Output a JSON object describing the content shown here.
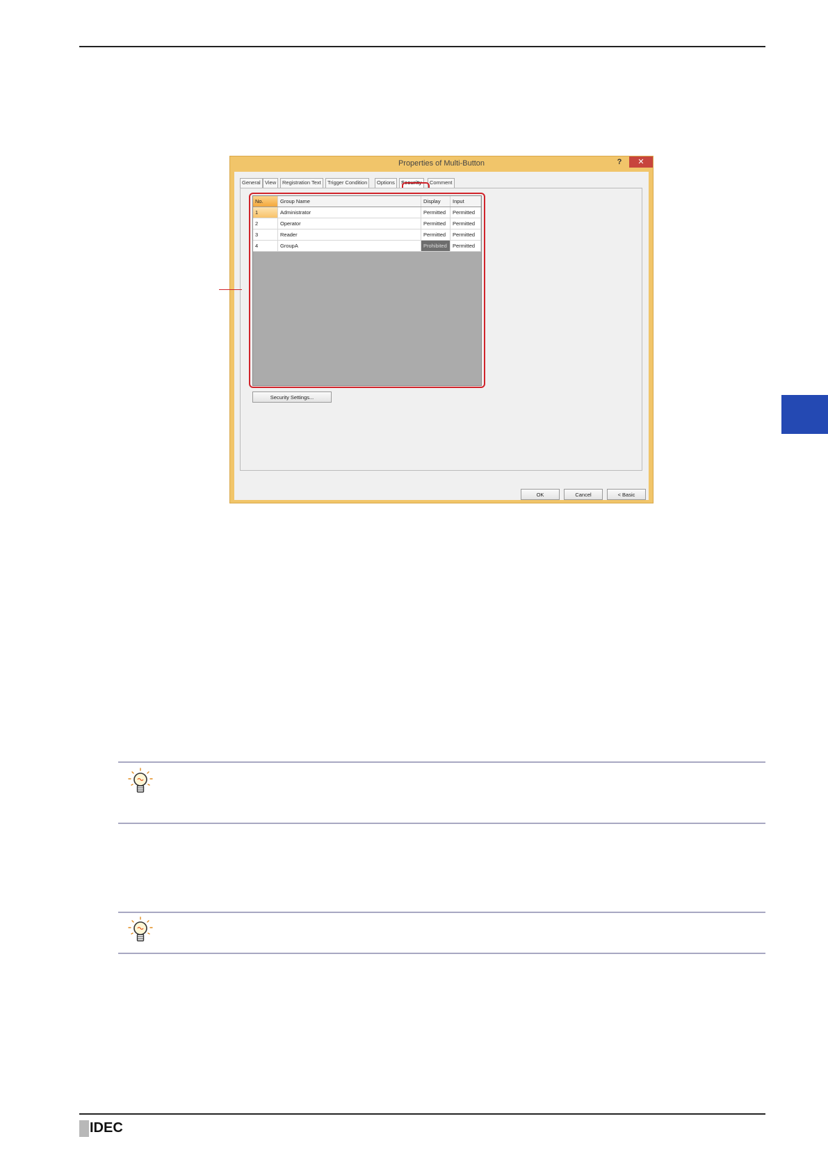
{
  "dialog": {
    "title": "Properties of Multi-Button",
    "help_label": "?",
    "close_label": "✕",
    "tabs": [
      {
        "label": "General"
      },
      {
        "label": "View"
      },
      {
        "label": "Registration Text"
      },
      {
        "label": "Trigger Condition"
      },
      {
        "label": "Options"
      },
      {
        "label": "Security"
      },
      {
        "label": "Comment"
      }
    ],
    "grid": {
      "headers": {
        "no": "No.",
        "name": "Group Name",
        "display": "Display",
        "input": "Input"
      },
      "rows": [
        {
          "no": "1",
          "name": "Administrator",
          "display": "Permitted",
          "input": "Permitted"
        },
        {
          "no": "2",
          "name": "Operator",
          "display": "Permitted",
          "input": "Permitted"
        },
        {
          "no": "3",
          "name": "Reader",
          "display": "Permitted",
          "input": "Permitted"
        },
        {
          "no": "4",
          "name": "GroupA",
          "display": "Prohibited",
          "input": "Permitted"
        }
      ]
    },
    "security_settings_label": "Security Settings...",
    "ok_label": "OK",
    "cancel_label": "Cancel",
    "basic_label": "< Basic"
  },
  "footer": {
    "brand": "IDEC"
  },
  "colors": {
    "accent_blue": "#2449b3",
    "highlight_red": "#d0232a",
    "dialog_frame": "#f1c56a"
  }
}
